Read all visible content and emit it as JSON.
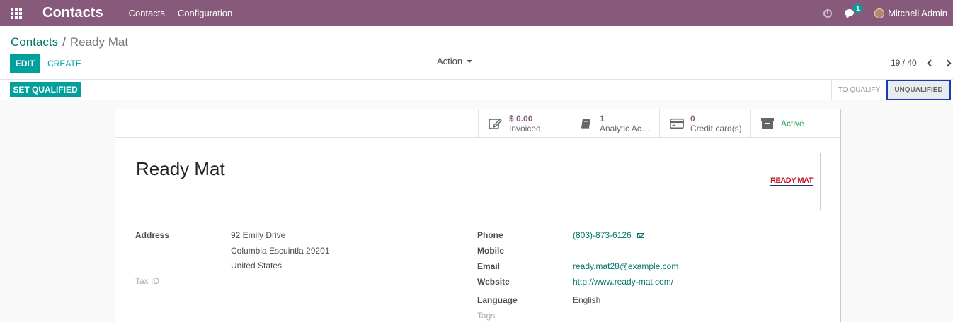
{
  "navbar": {
    "app_title": "Contacts",
    "menu": [
      "Contacts",
      "Configuration"
    ],
    "chat_badge": "1",
    "user_name": "Mitchell Admin",
    "color": "#875a7b"
  },
  "breadcrumb": {
    "parent": "Contacts",
    "separator": "/",
    "current": "Ready Mat"
  },
  "toolbar": {
    "edit_label": "EDIT",
    "create_label": "CREATE",
    "action_label": "Action",
    "pager_text": "19 / 40"
  },
  "statusbar": {
    "qualify_button": "SET QUALIFIED",
    "stages": [
      "TO QUALIFY",
      "UNQUALIFIED"
    ],
    "active_stage": "UNQUALIFIED"
  },
  "stat_buttons": {
    "invoiced": {
      "value": "$ 0.00",
      "label": "Invoiced",
      "icon": "pencil-square-icon"
    },
    "analytic": {
      "value": "1",
      "label": "Analytic Acc…",
      "icon": "book-icon"
    },
    "credit": {
      "value": "0",
      "label": "Credit card(s)",
      "icon": "credit-card-icon"
    },
    "active": {
      "label": "Active",
      "icon": "archive-icon"
    }
  },
  "partner": {
    "name": "Ready Mat",
    "logo_text": "READY MAT"
  },
  "fields": {
    "address_label": "Address",
    "street": "92 Emily Drive",
    "city_line": "Columbia  Escuintla  29201",
    "country": "United States",
    "tax_id_label": "Tax ID",
    "phone_label": "Phone",
    "phone": "(803)-873-6126",
    "mobile_label": "Mobile",
    "email_label": "Email",
    "email": "ready.mat28@example.com",
    "website_label": "Website",
    "website": "http://www.ready-mat.com/",
    "language_label": "Language",
    "language": "English",
    "tags_label": "Tags"
  },
  "colors": {
    "primary": "#00a09d",
    "link": "#00766d",
    "brand": "#875a7b",
    "active_green": "#28a745"
  }
}
